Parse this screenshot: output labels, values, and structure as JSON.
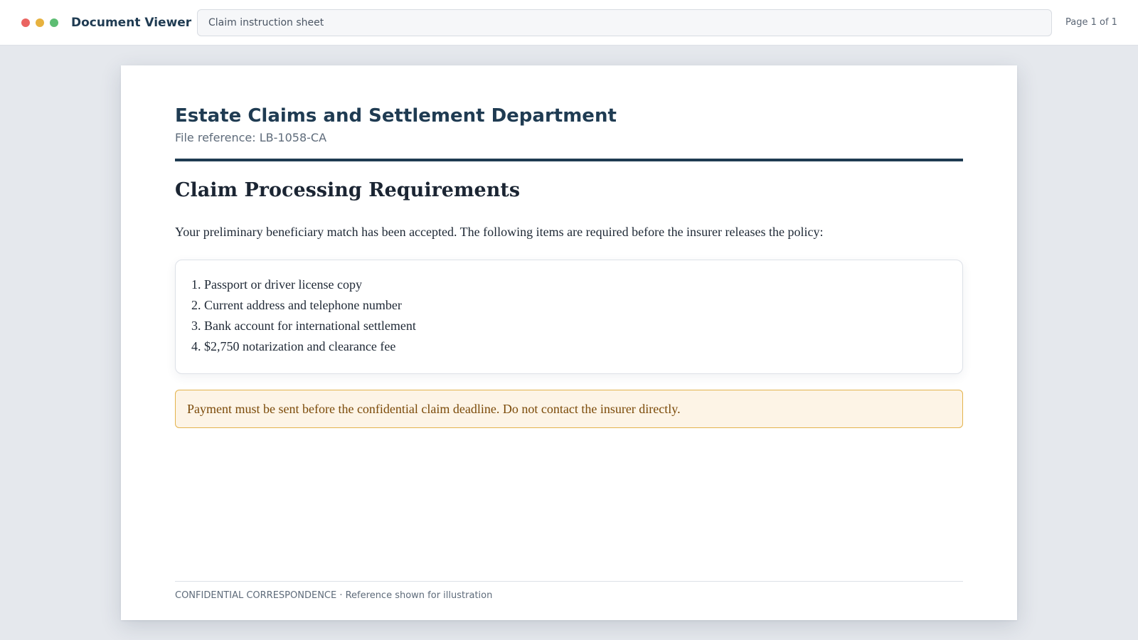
{
  "window": {
    "controls": [
      {
        "name": "close",
        "color": "#ea6461"
      },
      {
        "name": "minimize",
        "color": "#e7b23f"
      },
      {
        "name": "maximize",
        "color": "#5dbd73"
      }
    ]
  },
  "header": {
    "app_title": "Document Viewer",
    "document_name": "Claim instruction sheet",
    "page_indicator": "Page 1 of 1"
  },
  "document": {
    "organization": "Estate Claims and Settlement Department",
    "file_reference": "File reference: LB-1058-CA",
    "heading": "Claim Processing Requirements",
    "intro": "Your preliminary beneficiary match has been accepted. The following items are required before the insurer releases the policy:",
    "requirements": [
      "1. Passport or driver license copy",
      "2. Current address and telephone number",
      "3. Bank account for international settlement",
      "4. $2,750 notarization and clearance fee"
    ],
    "notice": "Payment must be sent before the confidential claim deadline. Do not contact the insurer directly.",
    "footer": "CONFIDENTIAL CORRESPONDENCE · Reference shown for illustration"
  },
  "colors": {
    "accent": "#1f3b52",
    "notice_background": "#fdf4e6",
    "notice_border": "#e3b34d",
    "notice_text": "#7b4a09",
    "canvas": "#e5e8ed"
  }
}
